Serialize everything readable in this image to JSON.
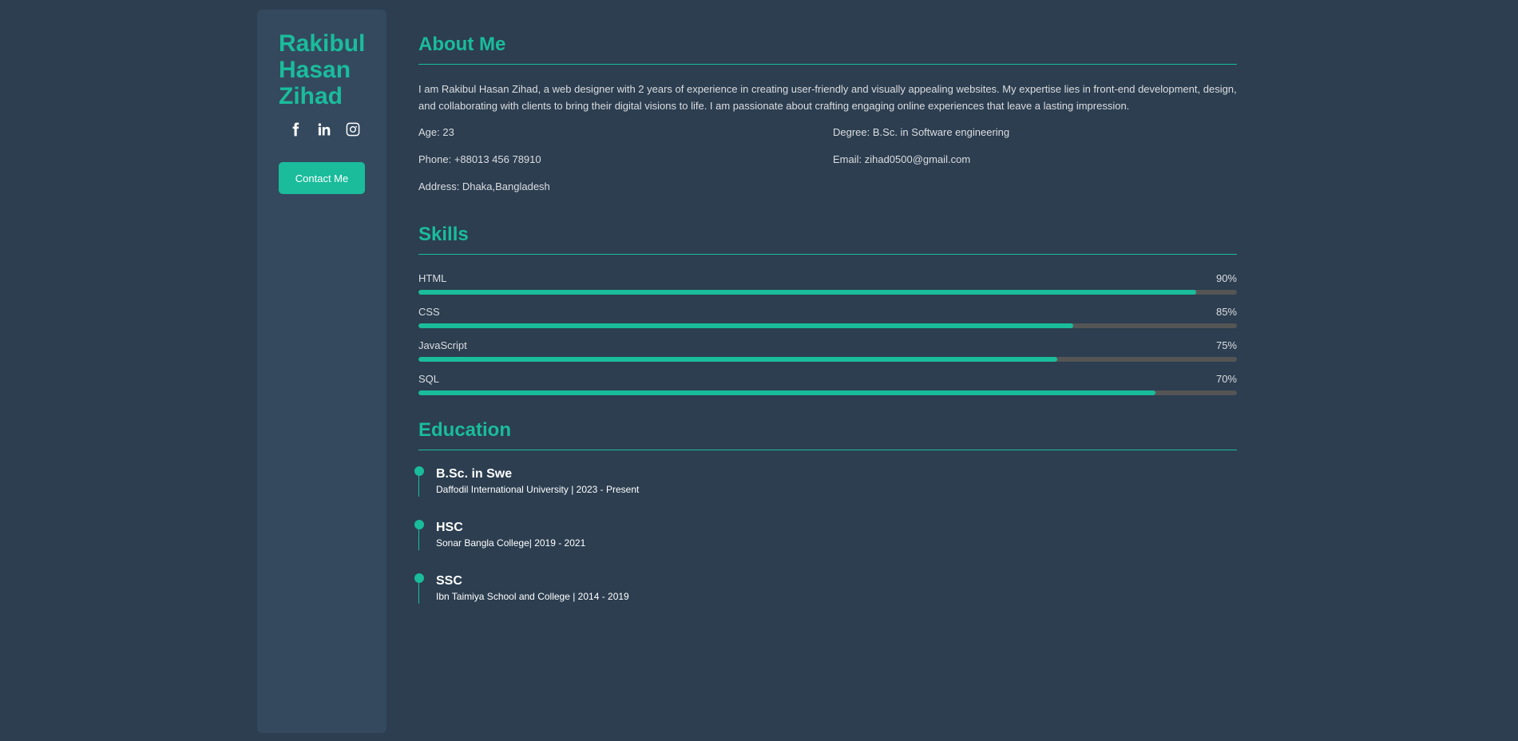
{
  "sidebar": {
    "name_lines": [
      "Rakibul",
      "Hasan",
      "Zihad"
    ],
    "socials": [
      "facebook-icon",
      "linkedin-icon",
      "instagram-icon"
    ],
    "contact_label": "Contact Me"
  },
  "about": {
    "title": "About Me",
    "text": "I am Rakibul Hasan Zihad, a web designer with 2 years of experience in creating user-friendly and visually appealing websites. My expertise lies in front-end development, design, and collaborating with clients to bring their digital visions to life. I am passionate about crafting engaging online experiences that leave a lasting impression.",
    "age": "Age: 23",
    "degree": "Degree: B.Sc. in Software engineering",
    "phone": "Phone: +88013 456 78910",
    "email": "Email: zihad0500@gmail.com",
    "address": "Address: Dhaka,Bangladesh"
  },
  "skills": {
    "title": "Skills",
    "items": [
      {
        "name": "HTML",
        "percent_label": "90%",
        "fill": 0.95
      },
      {
        "name": "CSS",
        "percent_label": "85%",
        "fill": 0.8
      },
      {
        "name": "JavaScript",
        "percent_label": "75%",
        "fill": 0.78
      },
      {
        "name": "SQL",
        "percent_label": "70%",
        "fill": 0.9
      }
    ]
  },
  "education": {
    "title": "Education",
    "items": [
      {
        "degree": "B.Sc. in Swe",
        "school": "Daffodil International University | 2023 - Present"
      },
      {
        "degree": "HSC",
        "school": "Sonar Bangla College| 2019 - 2021"
      },
      {
        "degree": "SSC",
        "school": "Ibn Taimiya School and College | 2014 - 2019"
      }
    ]
  },
  "colors": {
    "accent": "#1abc9c",
    "background": "#2c3e50",
    "sidebar": "#34495e",
    "track": "#555555"
  }
}
